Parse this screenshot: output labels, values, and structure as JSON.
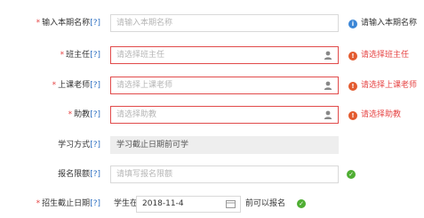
{
  "form": {
    "title_field": {
      "required": "*",
      "label": "输入本期名称",
      "help": "[?]",
      "placeholder": "请输入本期名称",
      "message": "请输入本期名称",
      "message_icon": "info-icon"
    },
    "head_teacher": {
      "required": "*",
      "label": "班主任",
      "help": "[?]",
      "placeholder": "请选择班主任",
      "message": "请选择班主任",
      "message_icon": "error-icon"
    },
    "lecturer": {
      "required": "*",
      "label": "上课老师",
      "help": "[?]",
      "placeholder": "请选择上课老师",
      "message": "请选择上课老师",
      "message_icon": "error-icon"
    },
    "assistant": {
      "required": "*",
      "label": "助教",
      "help": "[?]",
      "placeholder": "请选择助教",
      "message": "请选择助教",
      "message_icon": "error-icon"
    },
    "study_mode": {
      "label": "学习方式",
      "help": "[?]",
      "value": "学习截止日期前可学"
    },
    "enroll_limit": {
      "label": "报名限额",
      "help": "[?]",
      "placeholder": "请填写报名限额",
      "status_icon": "check-icon"
    },
    "enroll_deadline": {
      "required": "*",
      "label": "招生截止日期",
      "help": "[?]",
      "prefix": "学生在",
      "value": "2018-11-4",
      "suffix": "前可以报名",
      "status_icon": "check-icon"
    }
  },
  "colors": {
    "error": "#e64545",
    "info": "#3b86d6",
    "success": "#4fae33",
    "help_link": "#2d6fc1"
  }
}
